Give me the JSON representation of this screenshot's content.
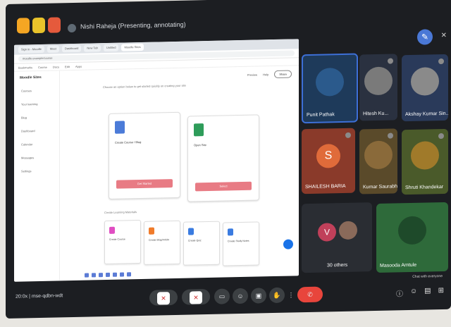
{
  "meeting": {
    "presenting_label": "Nishi Raheja (Presenting, annotating)",
    "time": "20:0x",
    "code": "mse-qdbn-wdt"
  },
  "browser": {
    "tabs": [
      "Sign in - Moodle",
      "Meet",
      "Dashboard",
      "New Tab",
      "Untitled",
      "Moodle Sites"
    ],
    "url": "moodle.example/course",
    "bookmarks": [
      "Bookmarks",
      "Course",
      "Docs",
      "Edit",
      "Apps"
    ]
  },
  "app": {
    "title": "Moodle Sites",
    "nav": [
      "Courses",
      "Your learning",
      "Blog",
      "Dashboard",
      "Calendar",
      "Messages",
      "Settings"
    ],
    "toolbar": [
      "Preview",
      "Help",
      "Share"
    ],
    "hint": "Choose an option below to get started quickly on creating your site",
    "cards": [
      {
        "title": "Create Course / Blog",
        "button": "Get Started",
        "color": "#4b7bd8"
      },
      {
        "title": "Open Site",
        "button": "Select",
        "color": "#2e9c5a"
      }
    ],
    "section_label": "Create Learning Materials",
    "minis": [
      {
        "title": "Create Course",
        "color": "#e04ec2"
      },
      {
        "title": "Create Blog/Article",
        "color": "#f07b2a"
      },
      {
        "title": "Create Quiz",
        "color": "#3a7be0"
      },
      {
        "title": "Create Study Notes",
        "color": "#3a7be0"
      }
    ]
  },
  "participants": [
    {
      "name": "Punit Pathak",
      "type": "photo",
      "bg": "#1e3a5a",
      "avatar": "#2b5a8c"
    },
    {
      "name": "Hitesh Ku...",
      "type": "photo",
      "bg": "#2a3140",
      "avatar": "#7a7a7a"
    },
    {
      "name": "Akshay Kumar Sin...",
      "type": "photo",
      "bg": "#2a3a5a",
      "avatar": "#8a8a8a"
    },
    {
      "name": "SHAILESH BARIA",
      "type": "letter",
      "letter": "S",
      "bg": "#8a3a2a",
      "avatar": "#e06b3a"
    },
    {
      "name": "Kumar Saurabh",
      "type": "photo",
      "bg": "#5a4a2a",
      "avatar": "#8a6a3a"
    },
    {
      "name": "Shruti Khandekar",
      "type": "photo",
      "bg": "#4a5a2a",
      "avatar": "#a07a2a"
    },
    {
      "name": "30 others",
      "type": "group",
      "bg": "#2a2d33",
      "letter": "V",
      "avatar": "#c0405a"
    },
    {
      "name": "Masooda Amtule",
      "type": "photo",
      "bg": "#2e6a3a",
      "avatar": "#1e4a2a"
    }
  ],
  "controls": {
    "leave": "✆",
    "chat_label": "Chat with everyone"
  }
}
